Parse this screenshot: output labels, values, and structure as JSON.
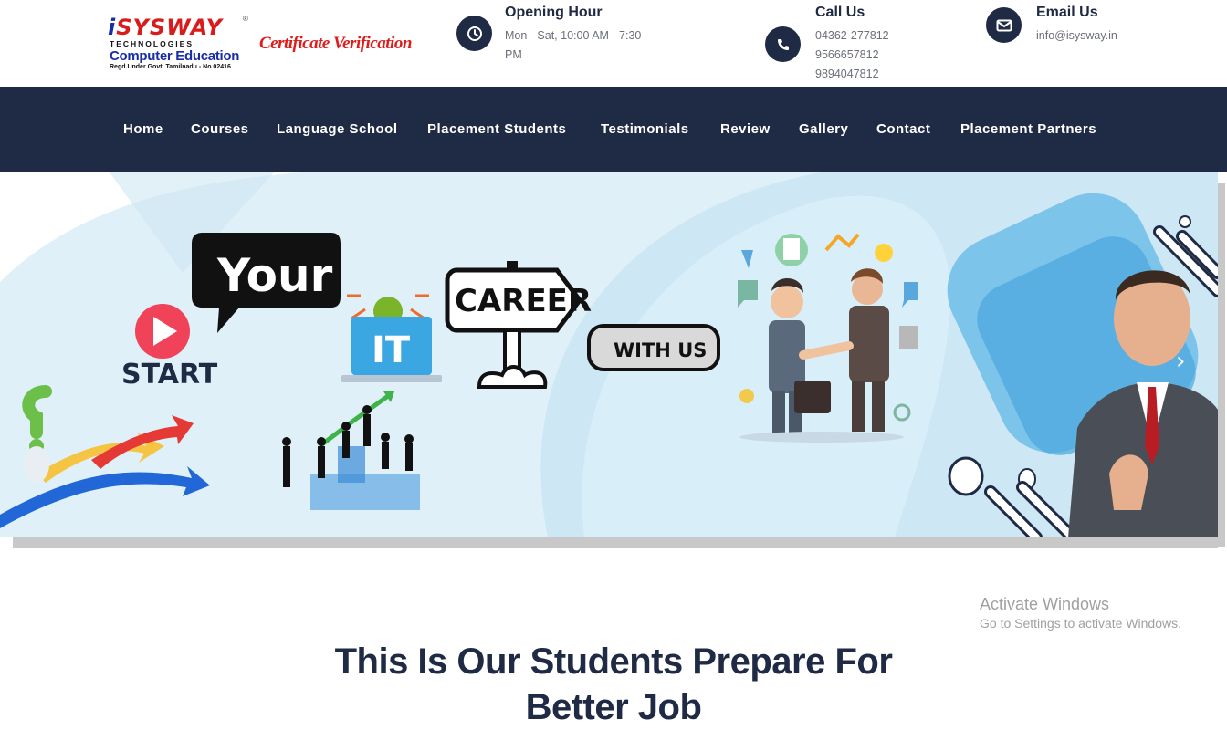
{
  "logo": {
    "brand_i": "i",
    "brand_rest": "SYSWAY",
    "sub": "TECHNOLOGIES",
    "name": "Computer Education",
    "reg_line": "Regd.Under Govt. Tamilnadu - No 02416",
    "reg_mark": "®"
  },
  "cert_link": "Certificate Verification",
  "opening": {
    "title": "Opening Hour",
    "line1": "Mon - Sat, 10:00 AM - 7:30",
    "line2": "PM",
    "icon": "clock-icon"
  },
  "call": {
    "title": "Call Us",
    "phones": [
      "04362-277812",
      "9566657812",
      "9894047812"
    ],
    "icon": "phone-icon"
  },
  "email": {
    "title": "Email Us",
    "address": "info@isysway.in",
    "icon": "envelope-icon"
  },
  "nav": [
    "Home",
    "Courses",
    "Language School",
    "Placement Students",
    "Testimonials",
    "Review",
    "Gallery",
    "Contact",
    "Placement Partners"
  ],
  "banner": {
    "start": "START",
    "your": "Your",
    "it": "IT",
    "career": "CAREER",
    "with_us": "WITH US",
    "next_arrow": "›"
  },
  "windows": {
    "line1": "Activate Windows",
    "line2": "Go to Settings to activate Windows."
  },
  "section": {
    "heading_line1": "This Is Our Students Prepare For",
    "heading_line2": "Better Job"
  },
  "colors": {
    "navy": "#1f2a44",
    "red": "#e01b1b",
    "blue": "#1a2da8",
    "banner_bg": "#dff0f8"
  }
}
